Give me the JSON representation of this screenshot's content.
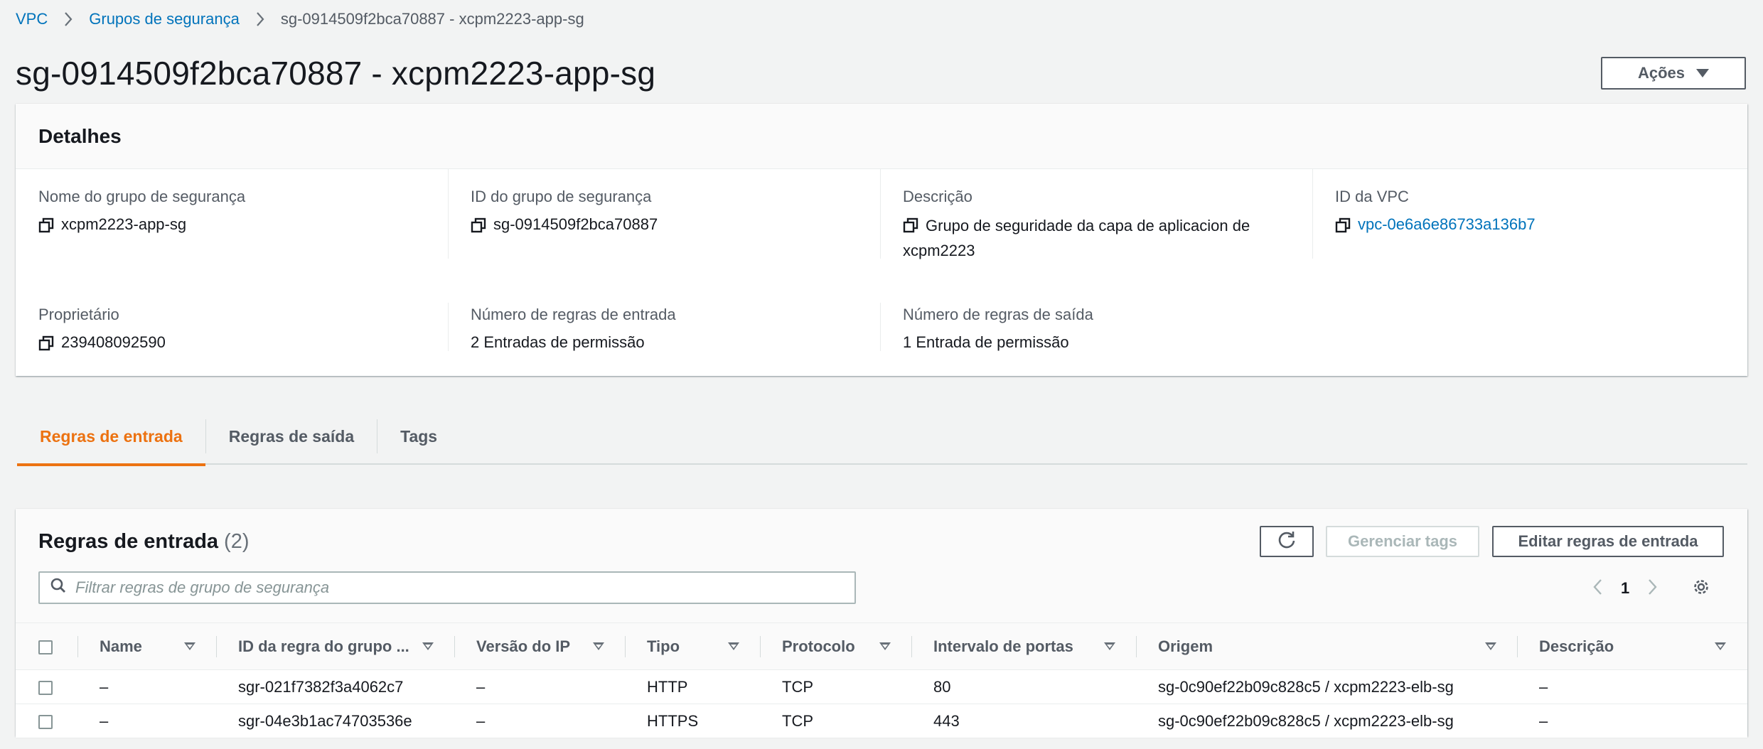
{
  "breadcrumb": {
    "items": [
      "VPC",
      "Grupos de segurança"
    ],
    "current": "sg-0914509f2bca70887 - xcpm2223-app-sg"
  },
  "page": {
    "title": "sg-0914509f2bca70887 - xcpm2223-app-sg",
    "actions_label": "Ações"
  },
  "details": {
    "header": "Detalhes",
    "fields": [
      {
        "label": "Nome do grupo de segurança",
        "value": "xcpm2223-app-sg",
        "copy": true
      },
      {
        "label": "ID do grupo de segurança",
        "value": "sg-0914509f2bca70887",
        "copy": true
      },
      {
        "label": "Descrição",
        "value": "Grupo de seguridade da capa de aplicacion de xcpm2223",
        "copy": true
      },
      {
        "label": "ID da VPC",
        "value": "vpc-0e6a6e86733a136b7",
        "copy": true,
        "link": true
      },
      {
        "label": "Proprietário",
        "value": "239408092590",
        "copy": true
      },
      {
        "label": "Número de regras de entrada",
        "value": "2 Entradas de permissão",
        "copy": false
      },
      {
        "label": "Número de regras de saída",
        "value": "1 Entrada de permissão",
        "copy": false
      }
    ]
  },
  "tabs": [
    {
      "label": "Regras de entrada",
      "active": true
    },
    {
      "label": "Regras de saída",
      "active": false
    },
    {
      "label": "Tags",
      "active": false
    }
  ],
  "rules": {
    "title": "Regras de entrada",
    "count": "(2)",
    "manage_tags_label": "Gerenciar tags",
    "edit_label": "Editar regras de entrada",
    "search_placeholder": "Filtrar regras de grupo de segurança",
    "page": "1",
    "columns": [
      "Name",
      "ID da regra do grupo ...",
      "Versão do IP",
      "Tipo",
      "Protocolo",
      "Intervalo de portas",
      "Origem",
      "Descrição"
    ],
    "rows": [
      [
        "–",
        "sgr-021f7382f3a4062c7",
        "–",
        "HTTP",
        "TCP",
        "80",
        "sg-0c90ef22b09c828c5 / xcpm2223-elb-sg",
        "–"
      ],
      [
        "–",
        "sgr-04e3b1ac74703536e",
        "–",
        "HTTPS",
        "TCP",
        "443",
        "sg-0c90ef22b09c828c5 / xcpm2223-elb-sg",
        "–"
      ]
    ]
  },
  "colors": {
    "link": "#0073bb",
    "accent": "#ec7211",
    "text": "#16191f",
    "secondary_text": "#545b64",
    "background": "#f2f3f3"
  },
  "icons": [
    "chevron-right-icon",
    "copy-icon",
    "caret-down-icon",
    "refresh-icon",
    "search-icon",
    "chevron-left-icon",
    "gear-icon",
    "filter-caret-icon"
  ]
}
